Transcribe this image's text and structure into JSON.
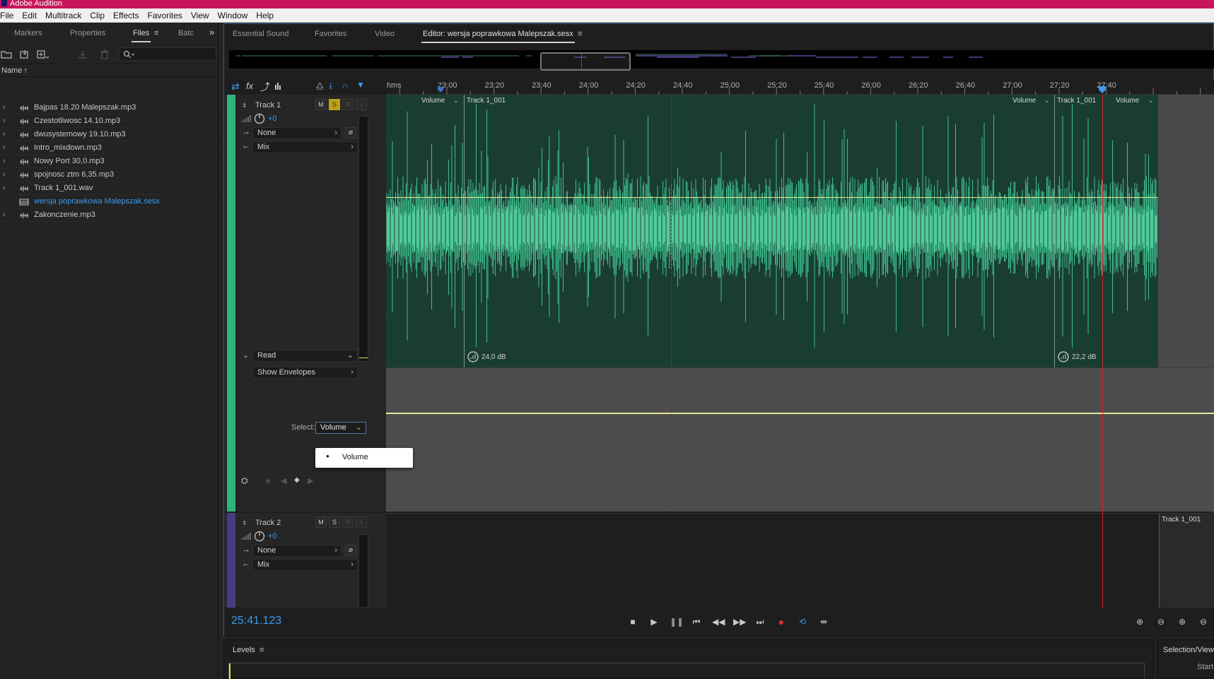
{
  "app": {
    "title": "Adobe Audition"
  },
  "menu": [
    "File",
    "Edit",
    "Multitrack",
    "Clip",
    "Effects",
    "Favorites",
    "View",
    "Window",
    "Help"
  ],
  "left_panel": {
    "tabs": [
      "Markers",
      "Properties",
      "Files",
      "Batc"
    ],
    "active_tab": "Files",
    "column_header": "Name",
    "files": [
      {
        "name": "Bajpas 18.20 Malepszak.mp3",
        "type": "audio"
      },
      {
        "name": "Czestotliwosc 14.10.mp3",
        "type": "audio"
      },
      {
        "name": "dwusystemowy 19.10.mp3",
        "type": "audio"
      },
      {
        "name": "Intro_mixdown.mp3",
        "type": "audio"
      },
      {
        "name": "Nowy Port 30,0.mp3",
        "type": "audio"
      },
      {
        "name": "spojnosc ztm 6,35.mp3",
        "type": "audio"
      },
      {
        "name": "Track 1_001.wav",
        "type": "audio"
      },
      {
        "name": "wersja poprawkowa Malepszak.sesx",
        "type": "session",
        "selected": true
      },
      {
        "name": "Zakonczenie.mp3",
        "type": "audio"
      }
    ]
  },
  "editor": {
    "tabs": [
      "Essential Sound",
      "Favorites",
      "Video",
      "Editor: wersja poprawkowa Malepszak.sesx"
    ],
    "active_tab": "Editor: wersja poprawkowa Malepszak.sesx",
    "ruler": {
      "unit": "hms",
      "labels": [
        "23:00",
        "23:20",
        "23:40",
        "24:00",
        "24:20",
        "24:40",
        "25:00",
        "25:20",
        "25:40",
        "26:00",
        "26:20",
        "26:40",
        "27:00",
        "27:20",
        "27:40"
      ]
    },
    "tracks": [
      {
        "name": "Track 1",
        "color": "#2fb57a",
        "buttons": [
          "M",
          "S",
          "R",
          "I"
        ],
        "volume": "+0",
        "input": "None",
        "output": "Mix",
        "automation_mode": "Read",
        "show_envelopes": "Show Envelopes",
        "select_label": "Select:",
        "select_value": "Volume",
        "clip_labels": [
          "Volume",
          "Track 1_001",
          "Volume",
          "Track 1_001",
          "Volume"
        ],
        "clip_gains": [
          "24,0 dB",
          "22,2 dB"
        ]
      },
      {
        "name": "Track 2",
        "color": "#4a3b80",
        "buttons": [
          "M",
          "S",
          "R",
          "I"
        ],
        "volume": "+0",
        "input": "None",
        "output": "Mix",
        "clip_labels": [
          "Track 1_001"
        ]
      }
    ],
    "popup_menu": {
      "items": [
        "Volume"
      ]
    },
    "timecode": "25:41.123"
  },
  "levels_panel": {
    "title": "Levels"
  },
  "selection_panel": {
    "title": "Selection/View",
    "start_label": "Start"
  },
  "colors": {
    "accent": "#3d9bef",
    "titlebar": "#c7145a",
    "waveform": "#3fbf8f",
    "clip_bg": "#1a3d32",
    "playhead": "#d62222",
    "envelope": "#e8e89a",
    "solo": "#bca21a"
  }
}
